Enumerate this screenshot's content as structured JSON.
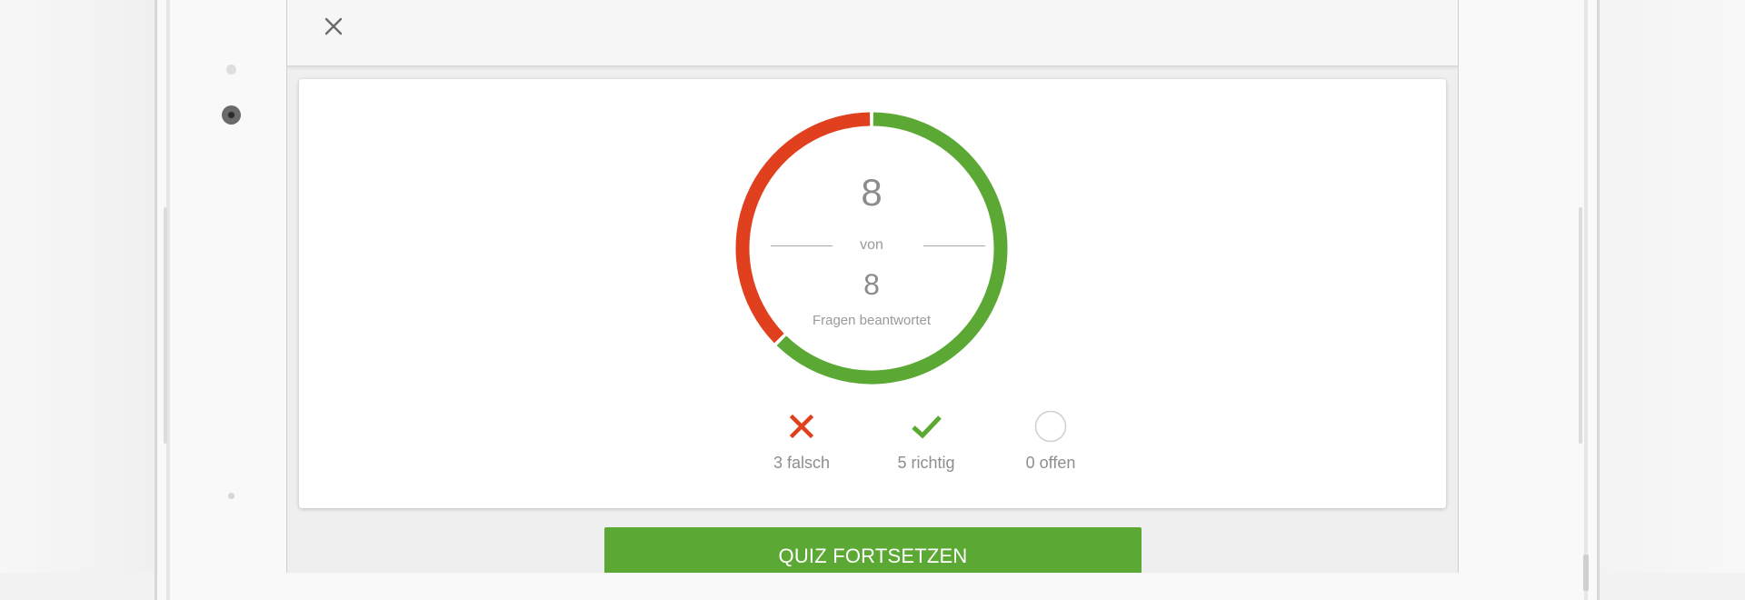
{
  "toolbar": {
    "close_icon": "close-icon"
  },
  "quiz": {
    "answered": "8",
    "of_label": "von",
    "total": "8",
    "caption": "Fragen beantwortet",
    "wrong_count": 3,
    "right_count": 5,
    "open_count": 0,
    "wrong_label": "3 falsch",
    "right_label": "5 richtig",
    "open_label": "0 offen"
  },
  "colors": {
    "wrong": "#e0401d",
    "right": "#5ba934",
    "open": "#d5d5d5",
    "button": "#5ba934"
  },
  "icons": {
    "wrong": "cross-icon",
    "right": "checkmark-icon",
    "open": "empty-circle-icon"
  },
  "continue_button": {
    "label": "QUIZ FORTSETZEN"
  }
}
